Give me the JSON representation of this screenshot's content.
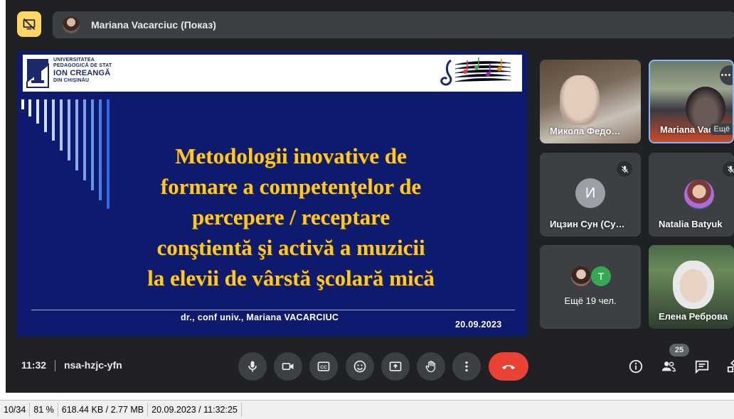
{
  "meeting": {
    "presenter_label": "Mariana Vacarciuc (Показ)",
    "clock": "11:32",
    "code": "nsa-hzjc-yfn",
    "participant_count": "25"
  },
  "slide": {
    "university_line1": "UNIVERSITATEA",
    "university_line2": "PEDAGOGICĂ DE STAT",
    "university_line3": "ION CREANGĂ",
    "university_line4": "DIN CHIȘINĂU",
    "title_lines": [
      "Metodologii inovative de",
      "formare a competenţelor de",
      "percepere / receptare",
      "conştientă şi activă a muzicii",
      "la elevii de vârstă şcolară mică"
    ],
    "author": "dr., conf univ., Mariana VACARCIUC",
    "date": "20.09.2023"
  },
  "participants": [
    {
      "name": "Микола Федо…"
    },
    {
      "name": "Mariana Vac",
      "tag": "Ещё"
    },
    {
      "name": "Ицзин Сун (Су…",
      "initial": "И"
    },
    {
      "name": "Natalia Batyuk"
    },
    {
      "more_label": "Ещё 19 чел.",
      "initial": "Т"
    },
    {
      "name": "Елена Реброва"
    }
  ],
  "statusbar": {
    "page": "10/34",
    "zoom": "81 %",
    "size": "618.44 KB / 2.77 MB",
    "datetime": "20.09.2023 / 11:32:25"
  },
  "colors": {
    "background": "#202124",
    "tile": "#3c4043",
    "slide_bg": "#0d1a6e",
    "title": "#ffc72c",
    "hangup": "#ea4335",
    "present": "#fdd663"
  },
  "icons": [
    "present-off-icon",
    "mic-icon",
    "camera-icon",
    "captions-icon",
    "emoji-icon",
    "present-icon",
    "hand-icon",
    "more-vert-icon",
    "hangup-icon",
    "info-icon",
    "people-icon",
    "chat-icon",
    "activities-icon",
    "mic-off-icon"
  ]
}
